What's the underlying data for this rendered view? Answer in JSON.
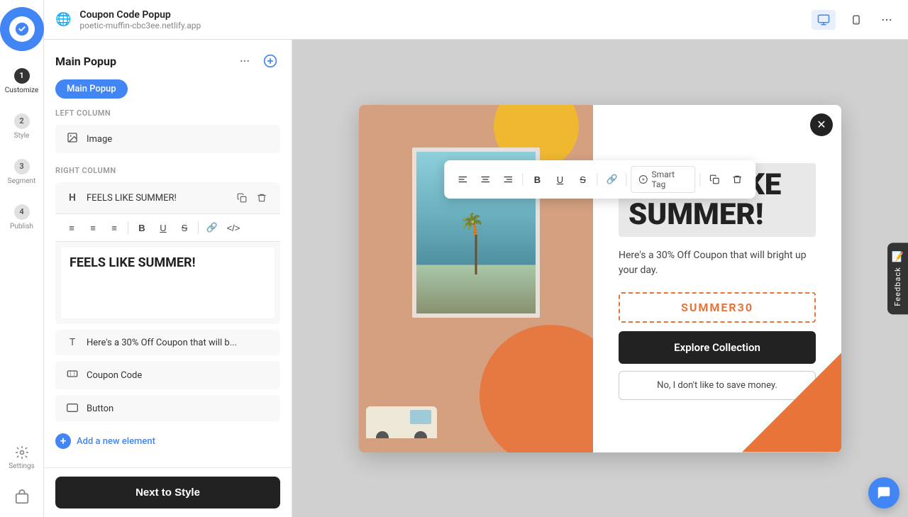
{
  "app": {
    "logo_icon": "app-logo",
    "title": "Coupon Code Popup",
    "url": "poetic-muffin-cbc3ee.netlify.app"
  },
  "sidebar": {
    "items": [
      {
        "id": "customize",
        "step": "1",
        "label": "Customize",
        "active": true
      },
      {
        "id": "style",
        "step": "2",
        "label": "Style"
      },
      {
        "id": "segment",
        "step": "3",
        "label": "Segment"
      },
      {
        "id": "publish",
        "step": "4",
        "label": "Publish"
      }
    ],
    "settings_label": "Settings"
  },
  "topbar": {
    "title": "Coupon Code Popup",
    "url": "poetic-muffin-cbc3ee.netlify.app",
    "device_desktop_label": "Desktop",
    "device_mobile_label": "Mobile",
    "more_label": "More options"
  },
  "panel": {
    "title": "Main Popup",
    "tab_label": "Main Popup",
    "left_column_label": "LEFT COLUMN",
    "right_column_label": "RIGHT COLUMN",
    "image_label": "Image",
    "heading_label": "FEELS LIKE SUMMER!",
    "paragraph_label": "Here's a 30% Off Coupon that will b...",
    "coupon_label": "Coupon Code",
    "button_label": "Button",
    "add_element_label": "Add a new element",
    "editor_content": "FEELS LIKE SUMMER!",
    "toolbar": {
      "align_left": "align-left",
      "align_center": "align-center",
      "align_right": "align-right",
      "bold": "bold",
      "underline": "underline",
      "strikethrough": "strikethrough",
      "link": "link",
      "code": "code"
    }
  },
  "popup": {
    "heading": "FEELS LIKE SUMMER!",
    "subtext": "Here's a 30% Off Coupon that will bright up your day.",
    "coupon_code": "SUMMER30",
    "explore_btn": "Explore Collection",
    "no_thanks_btn": "No, I don't like to save money."
  },
  "floating_toolbar": {
    "smart_tag_label": "Smart Tag",
    "copy_label": "Copy",
    "delete_label": "Delete"
  },
  "footer": {
    "next_btn": "Next to Style"
  },
  "feedback": {
    "label": "Feedback"
  }
}
